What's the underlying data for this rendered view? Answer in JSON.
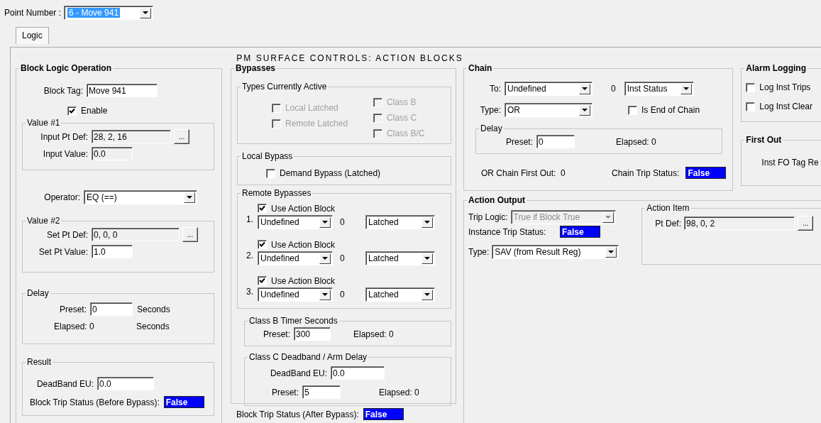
{
  "point_number": {
    "label": "Point Number :",
    "value": "6 - Move 941"
  },
  "tabs": [
    {
      "label": "Logic",
      "selected": true
    }
  ],
  "heading": "PM SURFACE CONTROLS: ACTION BLOCKS",
  "block_logic": {
    "title": "Block Logic Operation",
    "block_tag": {
      "label": "Block Tag:",
      "value": "Move 941",
      "readonly": false
    },
    "enable": {
      "label": "Enable",
      "checked": true,
      "disabled": false
    },
    "value1": {
      "title": "Value #1",
      "pt_def": {
        "label": "Input Pt Def:",
        "value": "28, 2, 16",
        "readonly": true,
        "button": "..."
      },
      "value": {
        "label": "Input Value:",
        "value": "0.0",
        "readonly": true
      }
    },
    "operator": {
      "label": "Operator:",
      "value": "EQ (==)"
    },
    "value2": {
      "title": "Value #2",
      "pt_def": {
        "label": "Set Pt Def:",
        "value": "0, 0, 0",
        "readonly": true,
        "button": "..."
      },
      "value": {
        "label": "Set Pt Value:",
        "value": "1.0",
        "readonly": false
      }
    },
    "delay": {
      "title": "Delay",
      "preset": {
        "label": "Preset:",
        "value": "0",
        "readonly": false
      },
      "preset_unit": "Seconds",
      "elapsed": "Elapsed: 0",
      "elapsed_unit": "Seconds"
    },
    "result": {
      "title": "Result",
      "deadband": {
        "label": "DeadBand EU:",
        "value": "0.0",
        "readonly": false
      },
      "status": {
        "label": "Block Trip Status (Before Bypass):",
        "value": "False"
      }
    }
  },
  "bypasses": {
    "title": "Bypasses",
    "types_active": {
      "title": "Types Currently Active",
      "checks": [
        {
          "label": "Local Latched",
          "checked": false,
          "disabled": true
        },
        {
          "label": "Remote Latched",
          "checked": false,
          "disabled": true
        },
        {
          "label": "Class B",
          "checked": false,
          "disabled": true
        },
        {
          "label": "Class C",
          "checked": false,
          "disabled": true
        },
        {
          "label": "Class B/C",
          "checked": false,
          "disabled": true
        }
      ]
    },
    "local_bypass": {
      "title": "Local Bypass",
      "check": {
        "label": "Demand Bypass (Latched)",
        "checked": false,
        "disabled": false
      }
    },
    "remote": {
      "title": "Remote Bypasses",
      "items": [
        {
          "number": "1.",
          "check": {
            "label": "Use Action Block",
            "checked": true,
            "disabled": false
          },
          "source": "Undefined",
          "count": "0",
          "mode": "Latched"
        },
        {
          "number": "2.",
          "check": {
            "label": "Use Action Block",
            "checked": true,
            "disabled": false
          },
          "source": "Undefined",
          "count": "0",
          "mode": "Latched"
        },
        {
          "number": "3.",
          "check": {
            "label": "Use Action Block",
            "checked": true,
            "disabled": false
          },
          "source": "Undefined",
          "count": "0",
          "mode": "Latched"
        }
      ]
    },
    "class_b": {
      "title": "Class B Timer Seconds",
      "preset": {
        "label": "Preset:",
        "value": "300",
        "readonly": false
      },
      "elapsed": "Elapsed: 0"
    },
    "class_c": {
      "title": "Class C Deadband / Arm Delay",
      "deadband": {
        "label": "DeadBand EU:",
        "value": "0.0",
        "readonly": false
      },
      "preset": {
        "label": "Preset:",
        "value": "5",
        "readonly": false
      },
      "elapsed": "Elapsed: 0"
    }
  },
  "after_status": {
    "label": "Block Trip Status (After Bypass):",
    "value": "False"
  },
  "chain": {
    "title": "Chain",
    "to": {
      "label": "To:",
      "value": "Undefined"
    },
    "to_count": "0",
    "to_mode": "Inst Status",
    "type": {
      "label": "Type:",
      "value": "OR"
    },
    "end_of_chain": {
      "label": "Is End of Chain",
      "checked": false,
      "disabled": false
    },
    "delay": {
      "title": "Delay",
      "preset": {
        "label": "Preset:",
        "value": "0",
        "readonly": false
      },
      "elapsed": "Elapsed: 0"
    },
    "first_out": {
      "label": "OR Chain First Out:",
      "value": "0"
    },
    "status": {
      "label": "Chain Trip Status:",
      "value": "False"
    }
  },
  "alarm_logging": {
    "title": "Alarm Logging",
    "checks": [
      {
        "label": "Log Inst Trips",
        "checked": false,
        "disabled": false
      },
      {
        "label": "Log Inst Clear",
        "checked": false,
        "disabled": false
      }
    ]
  },
  "first_out": {
    "title": "First Out",
    "text": "Inst FO Tag Re"
  },
  "action_output": {
    "title": "Action Output",
    "trip_logic": {
      "label": "Trip Logic:",
      "value": "True if Block True",
      "disabled": true
    },
    "status": {
      "label": "Instance Trip Status:",
      "value": "False"
    },
    "type": {
      "label": "Type:",
      "value": "SAV (from Result Reg)",
      "disabled": false
    },
    "action_item": {
      "title": "Action Item",
      "pt_def": {
        "label": "Pt Def:",
        "value": "98, 0, 2",
        "readonly": true,
        "button": "..."
      }
    }
  }
}
